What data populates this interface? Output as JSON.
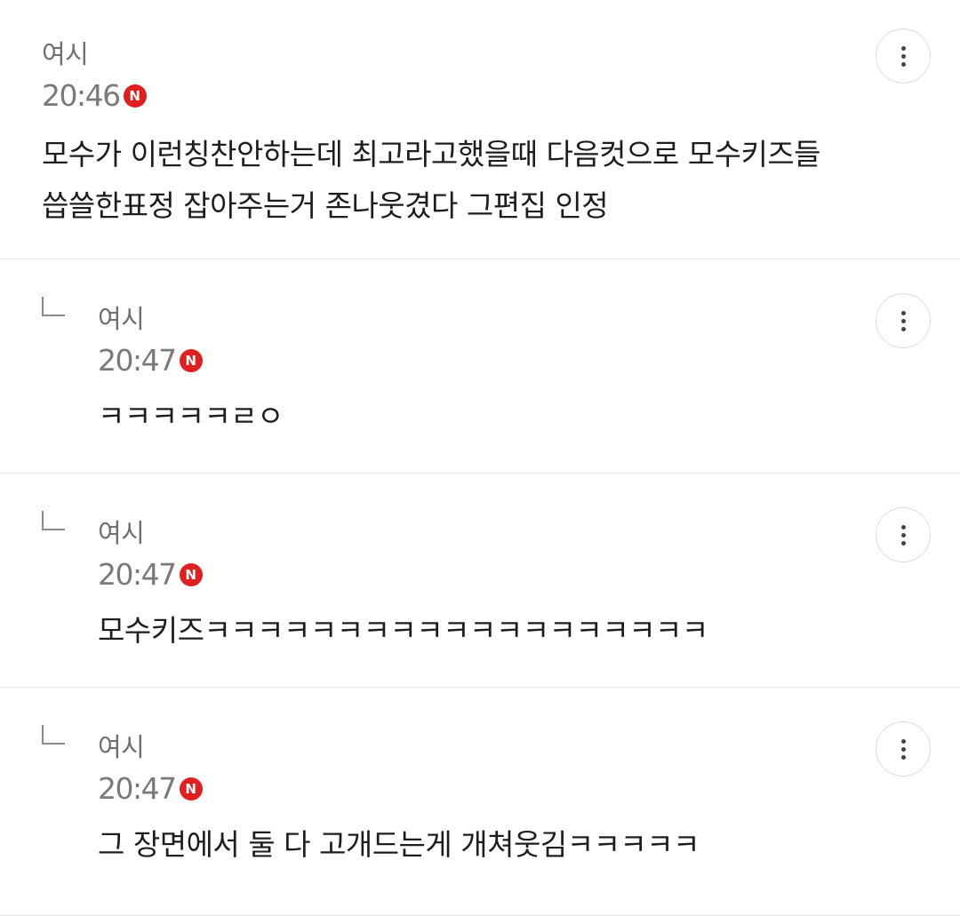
{
  "comments": [
    {
      "author": "여시",
      "time": "20:46",
      "badge": "N",
      "text_lines": [
        "모수가 이런칭찬안하는데 최고라고했을때 다음컷으로 모수키즈들",
        "씁쓸한표정 잡아주는거 존나웃겼다 그편집 인정"
      ]
    },
    {
      "author": "여시",
      "time": "20:47",
      "badge": "N",
      "text": "ㅋㅋㅋㅋㅋㄹㅇ"
    },
    {
      "author": "여시",
      "time": "20:47",
      "badge": "N",
      "text": "모수키즈ㅋㅋㅋㅋㅋㅋㅋㅋㅋㅋㅋㅋㅋㅋㅋㅋㅋㅋㅋ"
    },
    {
      "author": "여시",
      "time": "20:47",
      "badge": "N",
      "text": "그 장면에서 둘 다 고개드는게 개쳐웃김ㅋㅋㅋㅋㅋ"
    }
  ],
  "icons": {
    "more": "more-vertical-icon",
    "reply": "reply-arrow-icon",
    "new": "new-badge-icon"
  },
  "colors": {
    "new_badge": "#e02020",
    "divider": "#e4e4e4"
  }
}
